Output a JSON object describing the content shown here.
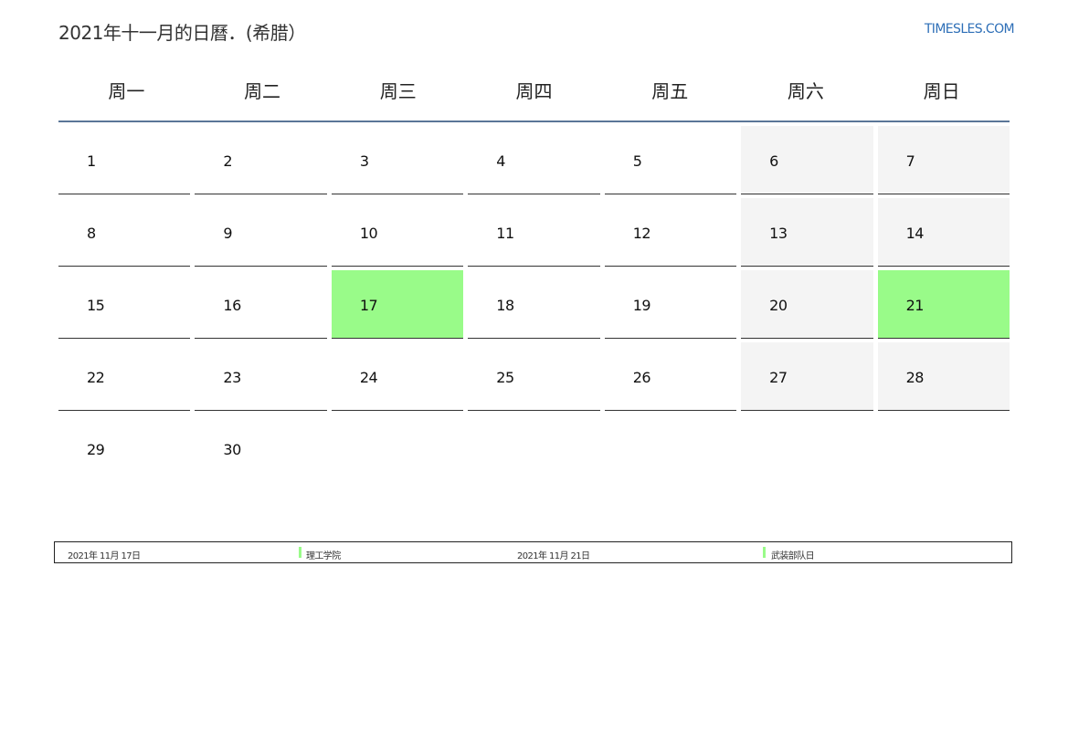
{
  "title": "2021年十一月的日曆．(希腊）",
  "site": "TIMESLES.COM",
  "weekdays": [
    "周一",
    "周二",
    "周三",
    "周四",
    "周五",
    "周六",
    "周日"
  ],
  "weeks": [
    [
      "1",
      "2",
      "3",
      "4",
      "5",
      "6",
      "7"
    ],
    [
      "8",
      "9",
      "10",
      "11",
      "12",
      "13",
      "14"
    ],
    [
      "15",
      "16",
      "17",
      "18",
      "19",
      "20",
      "21"
    ],
    [
      "22",
      "23",
      "24",
      "25",
      "26",
      "27",
      "28"
    ],
    [
      "29",
      "30",
      "",
      "",
      "",
      "",
      ""
    ]
  ],
  "highlight_color": "#99fb89",
  "weekend_color": "#f4f4f4",
  "holidays": [
    {
      "date": "2021年 11月 17日",
      "name": "理工学院"
    },
    {
      "date": "2021年 11月 21日",
      "name": "武装部队日"
    }
  ]
}
